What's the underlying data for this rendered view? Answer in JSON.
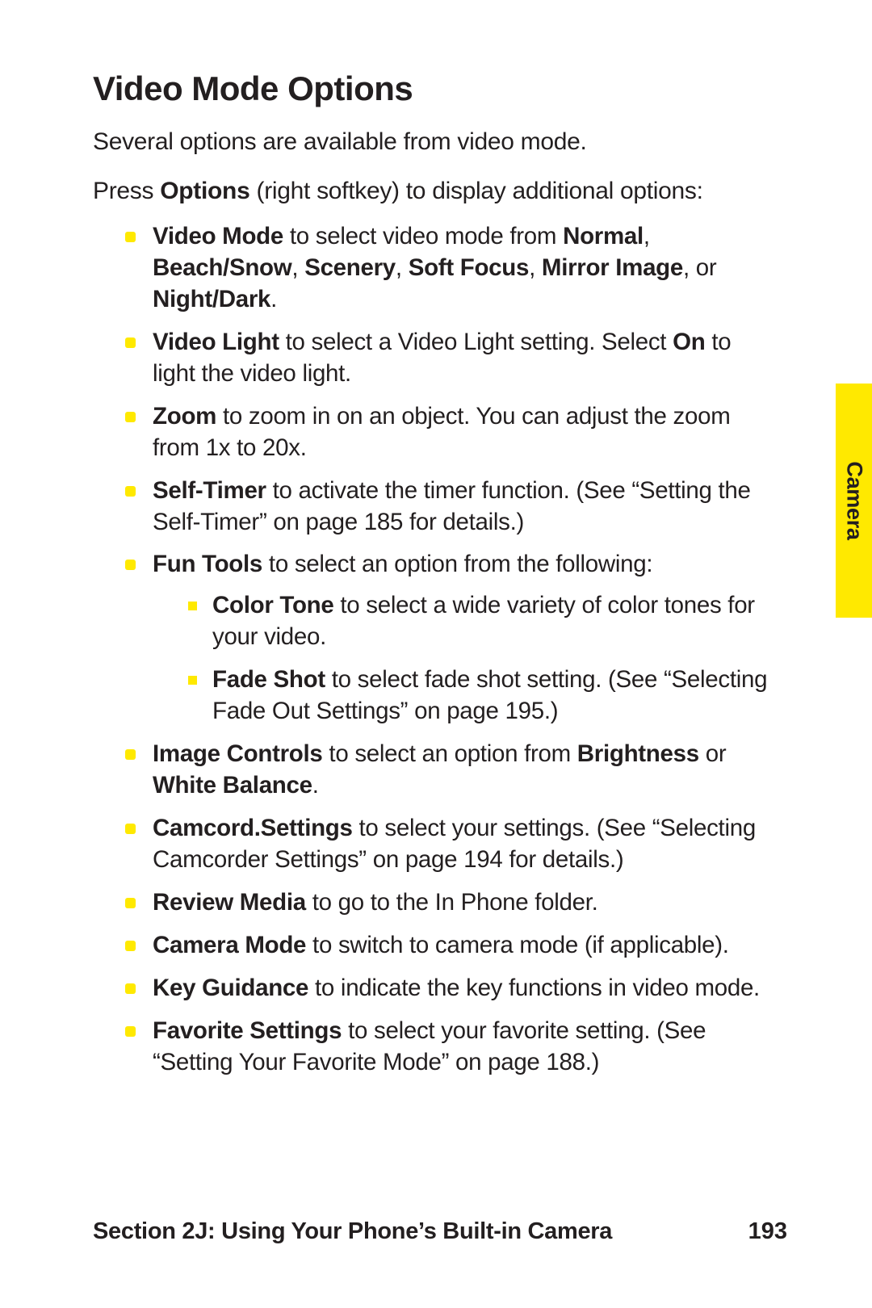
{
  "title": "Video Mode Options",
  "lead": "Several options are available from video mode.",
  "intro_pre": "Press ",
  "intro_bold": "Options",
  "intro_post": " (right softkey) to display additional options:",
  "options": [
    {
      "segments": [
        {
          "b": true,
          "t": "Video Mode"
        },
        {
          "b": false,
          "t": " to select video mode from "
        },
        {
          "b": true,
          "t": "Normal"
        },
        {
          "b": false,
          "t": ", "
        },
        {
          "b": true,
          "t": "Beach/Snow"
        },
        {
          "b": false,
          "t": ", "
        },
        {
          "b": true,
          "t": "Scenery"
        },
        {
          "b": false,
          "t": ", "
        },
        {
          "b": true,
          "t": "Soft Focus"
        },
        {
          "b": false,
          "t": ", "
        },
        {
          "b": true,
          "t": "Mirror Image"
        },
        {
          "b": false,
          "t": ", or "
        },
        {
          "b": true,
          "t": "Night/Dark"
        },
        {
          "b": false,
          "t": "."
        }
      ]
    },
    {
      "segments": [
        {
          "b": true,
          "t": "Video Light"
        },
        {
          "b": false,
          "t": " to select a Video Light setting. Select "
        },
        {
          "b": true,
          "t": "On"
        },
        {
          "b": false,
          "t": " to light the video light."
        }
      ]
    },
    {
      "segments": [
        {
          "b": true,
          "t": "Zoom"
        },
        {
          "b": false,
          "t": " to zoom in on an object. You can adjust the zoom from 1x to 20x."
        }
      ]
    },
    {
      "segments": [
        {
          "b": true,
          "t": "Self-Timer"
        },
        {
          "b": false,
          "t": " to activate the timer function. (See “Setting the Self-Timer” on page 185 for details.)"
        }
      ]
    },
    {
      "segments": [
        {
          "b": true,
          "t": "Fun Tools"
        },
        {
          "b": false,
          "t": " to select an option from the following:"
        }
      ],
      "sub": [
        {
          "segments": [
            {
              "b": true,
              "t": "Color Tone"
            },
            {
              "b": false,
              "t": " to select a wide variety of color tones for your video."
            }
          ]
        },
        {
          "segments": [
            {
              "b": true,
              "t": "Fade Shot"
            },
            {
              "b": false,
              "t": " to select fade shot setting. (See “Selecting Fade Out Settings” on page 195.)"
            }
          ]
        }
      ]
    },
    {
      "segments": [
        {
          "b": true,
          "t": "Image Controls"
        },
        {
          "b": false,
          "t": " to select an option from "
        },
        {
          "b": true,
          "t": "Brightness"
        },
        {
          "b": false,
          "t": " or "
        },
        {
          "b": true,
          "t": "White Balance"
        },
        {
          "b": false,
          "t": "."
        }
      ]
    },
    {
      "segments": [
        {
          "b": true,
          "t": "Camcord.Settings"
        },
        {
          "b": false,
          "t": " to select your settings. (See “Selecting Camcorder Settings” on page 194 for details.)"
        }
      ]
    },
    {
      "segments": [
        {
          "b": true,
          "t": "Review Media"
        },
        {
          "b": false,
          "t": " to go to the In Phone folder."
        }
      ]
    },
    {
      "segments": [
        {
          "b": true,
          "t": "Camera Mode"
        },
        {
          "b": false,
          "t": " to switch to camera mode (if applicable)."
        }
      ]
    },
    {
      "segments": [
        {
          "b": true,
          "t": "Key Guidance"
        },
        {
          "b": false,
          "t": " to indicate the key functions in video mode."
        }
      ]
    },
    {
      "segments": [
        {
          "b": true,
          "t": "Favorite Settings"
        },
        {
          "b": false,
          "t": " to select your favorite setting. (See “Setting Your Favorite Mode” on page 188.)"
        }
      ]
    }
  ],
  "side_tab": "Camera",
  "footer_section": "Section 2J: Using Your Phone’s Built-in Camera",
  "footer_page": "193"
}
